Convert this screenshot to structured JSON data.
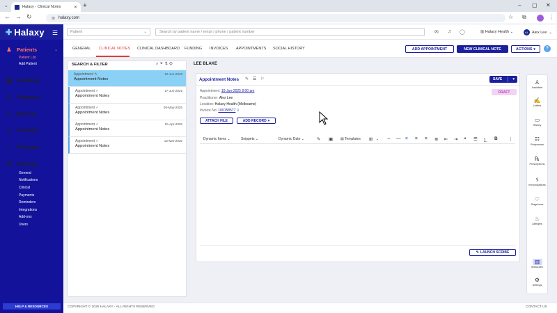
{
  "browser": {
    "tab_title": "Halaxy - Clinical Notes",
    "url": "halaxy.com"
  },
  "header": {
    "logo": "Halaxy",
    "patient_placeholder": "Patient",
    "search_placeholder": "Search by patient name / email / phone / patient number",
    "org": "Halaxy Health",
    "user_initials": "AL",
    "user_name": "Alex Lee"
  },
  "sidebar": {
    "items": [
      {
        "label": "Patients",
        "icon": "person-icon"
      },
      {
        "label": "Schedule",
        "icon": "calendar-icon"
      },
      {
        "label": "Finances",
        "icon": "dollar-icon"
      },
      {
        "label": "Reports",
        "icon": "chart-icon"
      },
      {
        "label": "Contacts",
        "icon": "contacts-icon"
      },
      {
        "label": "Personal",
        "icon": "user-icon"
      },
      {
        "label": "Settings",
        "icon": "gear-icon"
      }
    ],
    "patients_sub": [
      "Patient List",
      "Add Patient"
    ],
    "settings_sub": [
      "General",
      "Notifications",
      "Clinical",
      "Payments",
      "Reminders",
      "Integrations",
      "Add-ons",
      "Users"
    ],
    "help": "HELP & RESOURCES"
  },
  "tabs": [
    "GENERAL",
    "CLINICAL NOTES",
    "CLINICAL DASHBOARD",
    "FUNDING",
    "INVOICES",
    "APPOINTMENTS",
    "SOCIAL HISTORY"
  ],
  "actions": {
    "add_appointment": "ADD APPOINTMENT",
    "new_clinical_note": "NEW CLINICAL NOTE",
    "actions": "ACTIONS"
  },
  "list": {
    "heading": "SEARCH & FILTER",
    "notes": [
      {
        "type": "Appointment",
        "title": "Appointment Notes",
        "date": "10-Jun-2025"
      },
      {
        "type": "Appointment",
        "title": "Appointment Notes",
        "date": "17-Jun-2025"
      },
      {
        "type": "Appointment",
        "title": "Appointment Notes",
        "date": "06-May-2025"
      },
      {
        "type": "Appointment",
        "title": "Appointment Notes",
        "date": "10-Apr-2025"
      },
      {
        "type": "Appointment",
        "title": "Appointment Notes",
        "date": "13-Mar-2025"
      }
    ]
  },
  "patient": {
    "name": "LEE BLAKE"
  },
  "editor": {
    "title": "Appointment Notes",
    "save": "SAVE",
    "status": "DRAFT",
    "appointment_label": "Appointment:",
    "appointment_value": "10-Jun-2025 8:00 am",
    "practitioner_label": "Practitioner:",
    "practitioner_value": "Alex Lee",
    "location_label": "Location:",
    "location_value": "Halaxy Health (Melbourne)",
    "invoice_label": "Invoice No:",
    "invoice_value": "100158577",
    "attach_file": "ATTACH FILE",
    "add_record": "ADD RECORD",
    "toolbar": {
      "dynamic_items": "Dynamic Items",
      "snippets": "Snippets",
      "dynamic_date": "Dynamic Date",
      "templates": "Templates"
    },
    "launch_scribe": "LAUNCH SCRIBE"
  },
  "rail": [
    {
      "label": "Assistant",
      "icon": "assistant-icon"
    },
    {
      "label": "Letters",
      "icon": "letter-icon"
    },
    {
      "label": "History",
      "icon": "history-icon"
    },
    {
      "label": "Responses",
      "icon": "responses-icon"
    },
    {
      "label": "Prescriptions",
      "icon": "prescription-icon"
    },
    {
      "label": "Immunisations",
      "icon": "syringe-icon"
    },
    {
      "label": "Diagnoses",
      "icon": "heart-icon"
    },
    {
      "label": "Allergies",
      "icon": "allergy-icon"
    },
    {
      "label": "Measures",
      "icon": "measures-icon"
    },
    {
      "label": "Settings",
      "icon": "gear-icon"
    }
  ],
  "footer": {
    "copyright": "COPYRIGHT © 2025 HALAXY - ALL RIGHTS RESERVED",
    "contact": "CONTACT US"
  },
  "colors": {
    "brand": "#1b1f9e",
    "sidebar": "#12129a",
    "active_tab": "#e03a3a",
    "selected_note": "#8bd0f5",
    "draft": "#f3d3f3"
  }
}
